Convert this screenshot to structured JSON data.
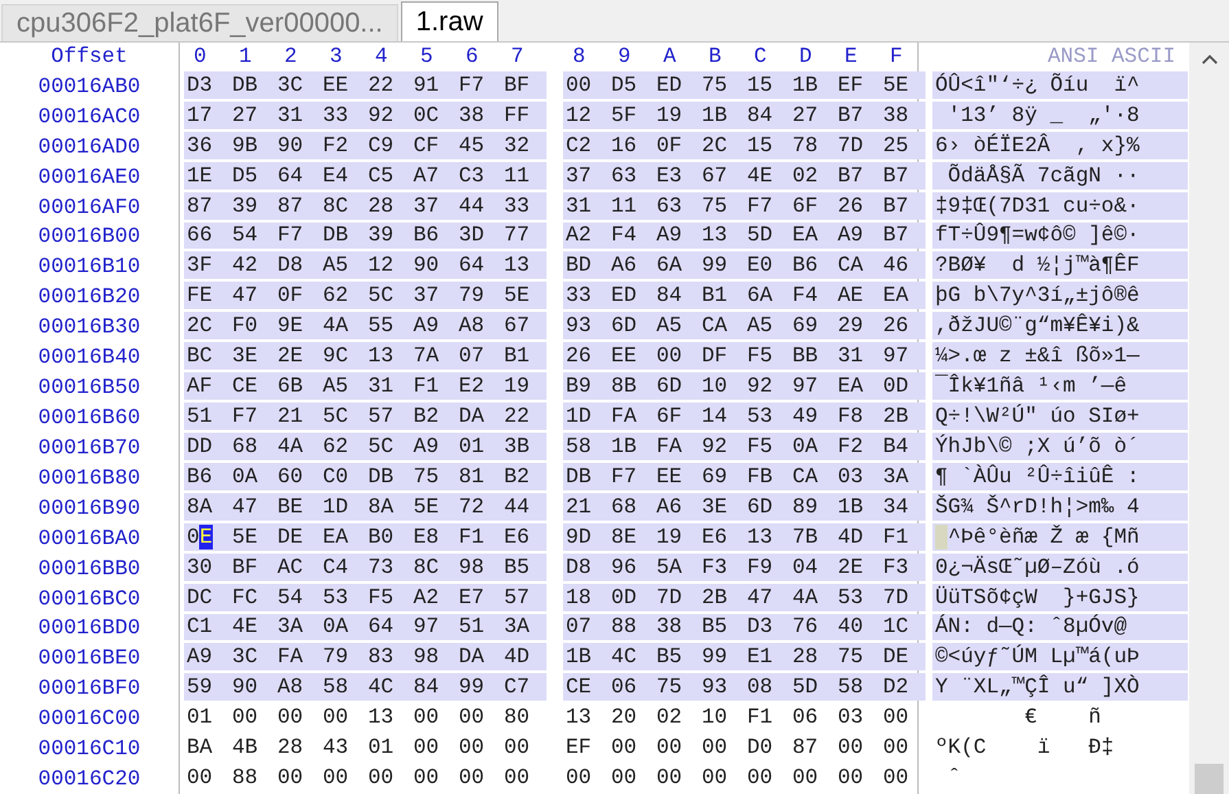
{
  "tabs": [
    {
      "label": "cpu306F2_plat6F_ver00000...",
      "selected": false
    },
    {
      "label": "1.raw",
      "selected": true
    }
  ],
  "header": {
    "offset": "Offset",
    "columns": [
      "0",
      "1",
      "2",
      "3",
      "4",
      "5",
      "6",
      "7",
      "8",
      "9",
      "A",
      "B",
      "C",
      "D",
      "E",
      "F"
    ],
    "ascii": "ANSI ASCII"
  },
  "rows": [
    {
      "offset": "00016AB0",
      "bytes": [
        "D3",
        "DB",
        "3C",
        "EE",
        "22",
        "91",
        "F7",
        "BF",
        "00",
        "D5",
        "ED",
        "75",
        "15",
        "1B",
        "EF",
        "5E"
      ],
      "ascii": "ÓÛ<î\"‘÷¿ Õíu  ï^",
      "selected": true,
      "cursor": false
    },
    {
      "offset": "00016AC0",
      "bytes": [
        "17",
        "27",
        "31",
        "33",
        "92",
        "0C",
        "38",
        "FF",
        "12",
        "5F",
        "19",
        "1B",
        "84",
        "27",
        "B7",
        "38"
      ],
      "ascii": " '13’ 8ÿ _  „'·8",
      "selected": true,
      "cursor": false
    },
    {
      "offset": "00016AD0",
      "bytes": [
        "36",
        "9B",
        "90",
        "F2",
        "C9",
        "CF",
        "45",
        "32",
        "C2",
        "16",
        "0F",
        "2C",
        "15",
        "78",
        "7D",
        "25"
      ],
      "ascii": "6› òÉÏE2Â  , x}%",
      "selected": true,
      "cursor": false
    },
    {
      "offset": "00016AE0",
      "bytes": [
        "1E",
        "D5",
        "64",
        "E4",
        "C5",
        "A7",
        "C3",
        "11",
        "37",
        "63",
        "E3",
        "67",
        "4E",
        "02",
        "B7",
        "B7"
      ],
      "ascii": " ÕdäÅ§Ã 7cãgN ··",
      "selected": true,
      "cursor": false
    },
    {
      "offset": "00016AF0",
      "bytes": [
        "87",
        "39",
        "87",
        "8C",
        "28",
        "37",
        "44",
        "33",
        "31",
        "11",
        "63",
        "75",
        "F7",
        "6F",
        "26",
        "B7"
      ],
      "ascii": "‡9‡Œ(7D31 cu÷o&·",
      "selected": true,
      "cursor": false
    },
    {
      "offset": "00016B00",
      "bytes": [
        "66",
        "54",
        "F7",
        "DB",
        "39",
        "B6",
        "3D",
        "77",
        "A2",
        "F4",
        "A9",
        "13",
        "5D",
        "EA",
        "A9",
        "B7"
      ],
      "ascii": "fT÷Û9¶=w¢ô© ]ê©·",
      "selected": true,
      "cursor": false
    },
    {
      "offset": "00016B10",
      "bytes": [
        "3F",
        "42",
        "D8",
        "A5",
        "12",
        "90",
        "64",
        "13",
        "BD",
        "A6",
        "6A",
        "99",
        "E0",
        "B6",
        "CA",
        "46"
      ],
      "ascii": "?BØ¥  d ½¦j™à¶ÊF",
      "selected": true,
      "cursor": false
    },
    {
      "offset": "00016B20",
      "bytes": [
        "FE",
        "47",
        "0F",
        "62",
        "5C",
        "37",
        "79",
        "5E",
        "33",
        "ED",
        "84",
        "B1",
        "6A",
        "F4",
        "AE",
        "EA"
      ],
      "ascii": "þG b\\7y^3í„±jô®ê",
      "selected": true,
      "cursor": false
    },
    {
      "offset": "00016B30",
      "bytes": [
        "2C",
        "F0",
        "9E",
        "4A",
        "55",
        "A9",
        "A8",
        "67",
        "93",
        "6D",
        "A5",
        "CA",
        "A5",
        "69",
        "29",
        "26"
      ],
      "ascii": ",ðžJU©¨g“m¥Ê¥i)&",
      "selected": true,
      "cursor": false
    },
    {
      "offset": "00016B40",
      "bytes": [
        "BC",
        "3E",
        "2E",
        "9C",
        "13",
        "7A",
        "07",
        "B1",
        "26",
        "EE",
        "00",
        "DF",
        "F5",
        "BB",
        "31",
        "97"
      ],
      "ascii": "¼>.œ z ±&î ßõ»1—",
      "selected": true,
      "cursor": false
    },
    {
      "offset": "00016B50",
      "bytes": [
        "AF",
        "CE",
        "6B",
        "A5",
        "31",
        "F1",
        "E2",
        "19",
        "B9",
        "8B",
        "6D",
        "10",
        "92",
        "97",
        "EA",
        "0D"
      ],
      "ascii": "¯Îk¥1ñâ ¹‹m ’—ê",
      "selected": true,
      "cursor": false
    },
    {
      "offset": "00016B60",
      "bytes": [
        "51",
        "F7",
        "21",
        "5C",
        "57",
        "B2",
        "DA",
        "22",
        "1D",
        "FA",
        "6F",
        "14",
        "53",
        "49",
        "F8",
        "2B"
      ],
      "ascii": "Q÷!\\W²Ú\" úo SIø+",
      "selected": true,
      "cursor": false
    },
    {
      "offset": "00016B70",
      "bytes": [
        "DD",
        "68",
        "4A",
        "62",
        "5C",
        "A9",
        "01",
        "3B",
        "58",
        "1B",
        "FA",
        "92",
        "F5",
        "0A",
        "F2",
        "B4"
      ],
      "ascii": "ÝhJb\\© ;X ú’õ ò´",
      "selected": true,
      "cursor": false
    },
    {
      "offset": "00016B80",
      "bytes": [
        "B6",
        "0A",
        "60",
        "C0",
        "DB",
        "75",
        "81",
        "B2",
        "DB",
        "F7",
        "EE",
        "69",
        "FB",
        "CA",
        "03",
        "3A"
      ],
      "ascii": "¶ `ÀÛu ²Û÷îiûÊ :",
      "selected": true,
      "cursor": false
    },
    {
      "offset": "00016B90",
      "bytes": [
        "8A",
        "47",
        "BE",
        "1D",
        "8A",
        "5E",
        "72",
        "44",
        "21",
        "68",
        "A6",
        "3E",
        "6D",
        "89",
        "1B",
        "34"
      ],
      "ascii": "ŠG¾ Š^rD!h¦>m‰ 4",
      "selected": true,
      "cursor": false
    },
    {
      "offset": "00016BA0",
      "bytes": [
        "0E",
        "5E",
        "DE",
        "EA",
        "B0",
        "E8",
        "F1",
        "E6",
        "9D",
        "8E",
        "19",
        "E6",
        "13",
        "7B",
        "4D",
        "F1"
      ],
      "ascii": " ^Þê°èñæ Ž æ {Mñ",
      "selected": true,
      "cursor": true
    },
    {
      "offset": "00016BB0",
      "bytes": [
        "30",
        "BF",
        "AC",
        "C4",
        "73",
        "8C",
        "98",
        "B5",
        "D8",
        "96",
        "5A",
        "F3",
        "F9",
        "04",
        "2E",
        "F3"
      ],
      "ascii": "0¿¬ÄsŒ˜µØ–Zóù .ó",
      "selected": true,
      "cursor": false
    },
    {
      "offset": "00016BC0",
      "bytes": [
        "DC",
        "FC",
        "54",
        "53",
        "F5",
        "A2",
        "E7",
        "57",
        "18",
        "0D",
        "7D",
        "2B",
        "47",
        "4A",
        "53",
        "7D"
      ],
      "ascii": "ÜüTSõ¢çW  }+GJS}",
      "selected": true,
      "cursor": false
    },
    {
      "offset": "00016BD0",
      "bytes": [
        "C1",
        "4E",
        "3A",
        "0A",
        "64",
        "97",
        "51",
        "3A",
        "07",
        "88",
        "38",
        "B5",
        "D3",
        "76",
        "40",
        "1C"
      ],
      "ascii": "ÁN: d—Q: ˆ8µÓv@",
      "selected": true,
      "cursor": false
    },
    {
      "offset": "00016BE0",
      "bytes": [
        "A9",
        "3C",
        "FA",
        "79",
        "83",
        "98",
        "DA",
        "4D",
        "1B",
        "4C",
        "B5",
        "99",
        "E1",
        "28",
        "75",
        "DE"
      ],
      "ascii": "©<úyƒ˜ÚM Lµ™á(uÞ",
      "selected": true,
      "cursor": false
    },
    {
      "offset": "00016BF0",
      "bytes": [
        "59",
        "90",
        "A8",
        "58",
        "4C",
        "84",
        "99",
        "C7",
        "CE",
        "06",
        "75",
        "93",
        "08",
        "5D",
        "58",
        "D2"
      ],
      "ascii": "Y ¨XL„™ÇÎ u“ ]XÒ",
      "selected": true,
      "cursor": false
    },
    {
      "offset": "00016C00",
      "bytes": [
        "01",
        "00",
        "00",
        "00",
        "13",
        "00",
        "00",
        "80",
        "13",
        "20",
        "02",
        "10",
        "F1",
        "06",
        "03",
        "00"
      ],
      "ascii": "       €    ñ",
      "selected": false,
      "cursor": false
    },
    {
      "offset": "00016C10",
      "bytes": [
        "BA",
        "4B",
        "28",
        "43",
        "01",
        "00",
        "00",
        "00",
        "EF",
        "00",
        "00",
        "00",
        "D0",
        "87",
        "00",
        "00"
      ],
      "ascii": "ºK(C    ï   Ð‡",
      "selected": false,
      "cursor": false
    },
    {
      "offset": "00016C20",
      "bytes": [
        "00",
        "88",
        "00",
        "00",
        "00",
        "00",
        "00",
        "00",
        "00",
        "00",
        "00",
        "00",
        "00",
        "00",
        "00",
        "00"
      ],
      "ascii": " ˆ",
      "selected": false,
      "cursor": false
    }
  ]
}
